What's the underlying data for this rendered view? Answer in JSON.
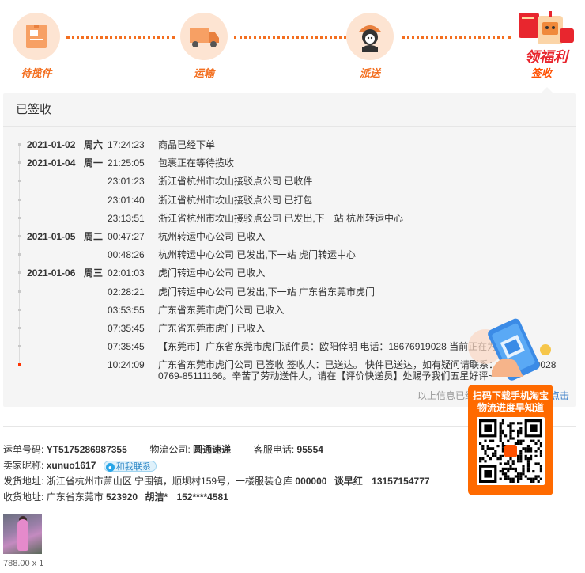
{
  "steps": [
    {
      "label": "待揽件",
      "icon": "package-icon"
    },
    {
      "label": "运输",
      "icon": "truck-icon"
    },
    {
      "label": "派送",
      "icon": "courier-icon"
    },
    {
      "label": "签收",
      "icon": "signed-icon"
    }
  ],
  "welfare": {
    "label": "领福利"
  },
  "panel": {
    "title": "已签收",
    "footer_prefix": "以上信息已经过优化处理，如需",
    "footer_link": "点击"
  },
  "timeline": [
    {
      "date": "2021-01-02",
      "weekday": "周六",
      "time": "17:24:23",
      "info": "商品已经下单"
    },
    {
      "date": "2021-01-04",
      "weekday": "周一",
      "time": "21:25:05",
      "info": "包裹正在等待揽收"
    },
    {
      "date": "",
      "weekday": "",
      "time": "23:01:23",
      "info": "浙江省杭州市坎山接驳点公司 已收件"
    },
    {
      "date": "",
      "weekday": "",
      "time": "23:01:40",
      "info": "浙江省杭州市坎山接驳点公司 已打包"
    },
    {
      "date": "",
      "weekday": "",
      "time": "23:13:51",
      "info": "浙江省杭州市坎山接驳点公司 已发出,下一站 杭州转运中心"
    },
    {
      "date": "2021-01-05",
      "weekday": "周二",
      "time": "00:47:27",
      "info": "杭州转运中心公司 已收入"
    },
    {
      "date": "",
      "weekday": "",
      "time": "00:48:26",
      "info": "杭州转运中心公司 已发出,下一站 虎门转运中心"
    },
    {
      "date": "2021-01-06",
      "weekday": "周三",
      "time": "02:01:03",
      "info": "虎门转运中心公司 已收入"
    },
    {
      "date": "",
      "weekday": "",
      "time": "02:28:21",
      "info": "虎门转运中心公司 已发出,下一站 广东省东莞市虎门"
    },
    {
      "date": "",
      "weekday": "",
      "time": "03:53:55",
      "info": "广东省东莞市虎门公司 已收入"
    },
    {
      "date": "",
      "weekday": "",
      "time": "07:35:45",
      "info": "广东省东莞市虎门 已收入"
    },
    {
      "date": "",
      "weekday": "",
      "time": "07:35:45",
      "info": "【东莞市】广东省东莞市虎门派件员：欧阳倖明 电话：18676919028 当前正在为您派件"
    },
    {
      "date": "",
      "weekday": "",
      "time": "10:24:09",
      "info": "广东省东莞市虎门公司 已签收 签收人：已送达。 快件已送达，如有疑问请联系：18676919028 0769-85111166。辛苦了劳动送件人，请在【评价快递员】处赐予我们五星好评~"
    }
  ],
  "order": {
    "waybill_label": "运单号码:",
    "waybill_no": "YT5175286987355",
    "company_label": "物流公司:",
    "company": "圆通速递",
    "service_label": "客服电话:",
    "service_phone": "95554",
    "seller_label": "卖家昵称:",
    "seller": "xunuo1617",
    "chat_label": "和我联系",
    "ship_label": "发货地址:",
    "ship_address": "浙江省杭州市萧山区 宁围镇，顺坝村159号，一楼服装仓库",
    "ship_zip": "000000",
    "ship_name": "谈早红",
    "ship_phone": "13157154777",
    "recv_label": "收货地址:",
    "recv_address": "广东省东莞市",
    "recv_zip": "523920",
    "recv_name": "胡洁*",
    "recv_phone": "152****4581"
  },
  "product": {
    "price": "788.00 x 1"
  },
  "promo": {
    "line1": "扫码下载手机淘宝",
    "line2": "物流进度早知道"
  },
  "colors": {
    "accent": "#f36f20",
    "panel_bg": "#f5f5f5",
    "promo": "#ff6a00",
    "link": "#3c7ec7"
  }
}
